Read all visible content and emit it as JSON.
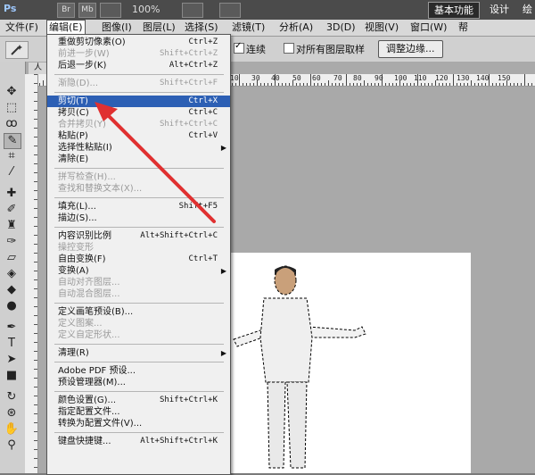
{
  "app": {
    "logo": "Ps",
    "bridge_label": "Br",
    "minibridge_label": "Mb",
    "zoom": "100%",
    "workspace_active": "基本功能",
    "workspace_design": "设计",
    "workspace_paint": "绘"
  },
  "menubar": [
    "文件(F)",
    "编辑(E)",
    "图像(I)",
    "图层(L)",
    "选择(S)",
    "滤镜(T)",
    "分析(A)",
    "3D(D)",
    "视图(V)",
    "窗口(W)",
    "帮"
  ],
  "options": {
    "contiguous_label": "连续",
    "sample_all_label": "对所有图层取样",
    "refine_edge_label": "调整边缘..."
  },
  "document_tab": "人",
  "ruler_numbers": [
    "10",
    "30",
    "40",
    "50",
    "60",
    "70",
    "80",
    "90",
    "100",
    "110",
    "120",
    "130",
    "140",
    "150"
  ],
  "edit_menu": [
    {
      "label": "重做剪切像素(O)",
      "shortcut": "Ctrl+Z",
      "state": "normal"
    },
    {
      "label": "前进一步(W)",
      "shortcut": "Shift+Ctrl+Z",
      "state": "disabled"
    },
    {
      "label": "后退一步(K)",
      "shortcut": "Alt+Ctrl+Z",
      "state": "normal"
    },
    {
      "sep": true
    },
    {
      "label": "渐隐(D)...",
      "shortcut": "Shift+Ctrl+F",
      "state": "disabled"
    },
    {
      "sep": true
    },
    {
      "label": "剪切(T)",
      "shortcut": "Ctrl+X",
      "state": "highlighted"
    },
    {
      "label": "拷贝(C)",
      "shortcut": "Ctrl+C",
      "state": "normal"
    },
    {
      "label": "合并拷贝(Y)",
      "shortcut": "Shift+Ctrl+C",
      "state": "disabled"
    },
    {
      "label": "粘贴(P)",
      "shortcut": "Ctrl+V",
      "state": "normal"
    },
    {
      "label": "选择性粘贴(I)",
      "shortcut": "",
      "state": "normal",
      "submenu": true
    },
    {
      "label": "清除(E)",
      "shortcut": "",
      "state": "normal"
    },
    {
      "sep": true
    },
    {
      "label": "拼写检查(H)...",
      "shortcut": "",
      "state": "disabled"
    },
    {
      "label": "查找和替换文本(X)...",
      "shortcut": "",
      "state": "disabled"
    },
    {
      "sep": true
    },
    {
      "label": "填充(L)...",
      "shortcut": "Shift+F5",
      "state": "normal"
    },
    {
      "label": "描边(S)...",
      "shortcut": "",
      "state": "normal"
    },
    {
      "sep": true
    },
    {
      "label": "内容识别比例",
      "shortcut": "Alt+Shift+Ctrl+C",
      "state": "normal"
    },
    {
      "label": "操控变形",
      "shortcut": "",
      "state": "disabled"
    },
    {
      "label": "自由变换(F)",
      "shortcut": "Ctrl+T",
      "state": "normal"
    },
    {
      "label": "变换(A)",
      "shortcut": "",
      "state": "normal",
      "submenu": true
    },
    {
      "label": "自动对齐图层...",
      "shortcut": "",
      "state": "disabled"
    },
    {
      "label": "自动混合图层...",
      "shortcut": "",
      "state": "disabled"
    },
    {
      "sep": true
    },
    {
      "label": "定义画笔预设(B)...",
      "shortcut": "",
      "state": "normal"
    },
    {
      "label": "定义图案...",
      "shortcut": "",
      "state": "disabled"
    },
    {
      "label": "定义自定形状...",
      "shortcut": "",
      "state": "disabled"
    },
    {
      "sep": true
    },
    {
      "label": "清理(R)",
      "shortcut": "",
      "state": "normal",
      "submenu": true
    },
    {
      "sep": true
    },
    {
      "label": "Adobe PDF 预设...",
      "shortcut": "",
      "state": "normal"
    },
    {
      "label": "预设管理器(M)...",
      "shortcut": "",
      "state": "normal"
    },
    {
      "sep": true
    },
    {
      "label": "颜色设置(G)...",
      "shortcut": "Shift+Ctrl+K",
      "state": "normal"
    },
    {
      "label": "指定配置文件...",
      "shortcut": "",
      "state": "normal"
    },
    {
      "label": "转换为配置文件(V)...",
      "shortcut": "",
      "state": "normal"
    },
    {
      "sep": true
    },
    {
      "label": "键盘快捷键...",
      "shortcut": "Alt+Shift+Ctrl+K",
      "state": "normal"
    }
  ],
  "colors": {
    "highlight": "#2c5fb4",
    "arrow": "#e03030"
  }
}
